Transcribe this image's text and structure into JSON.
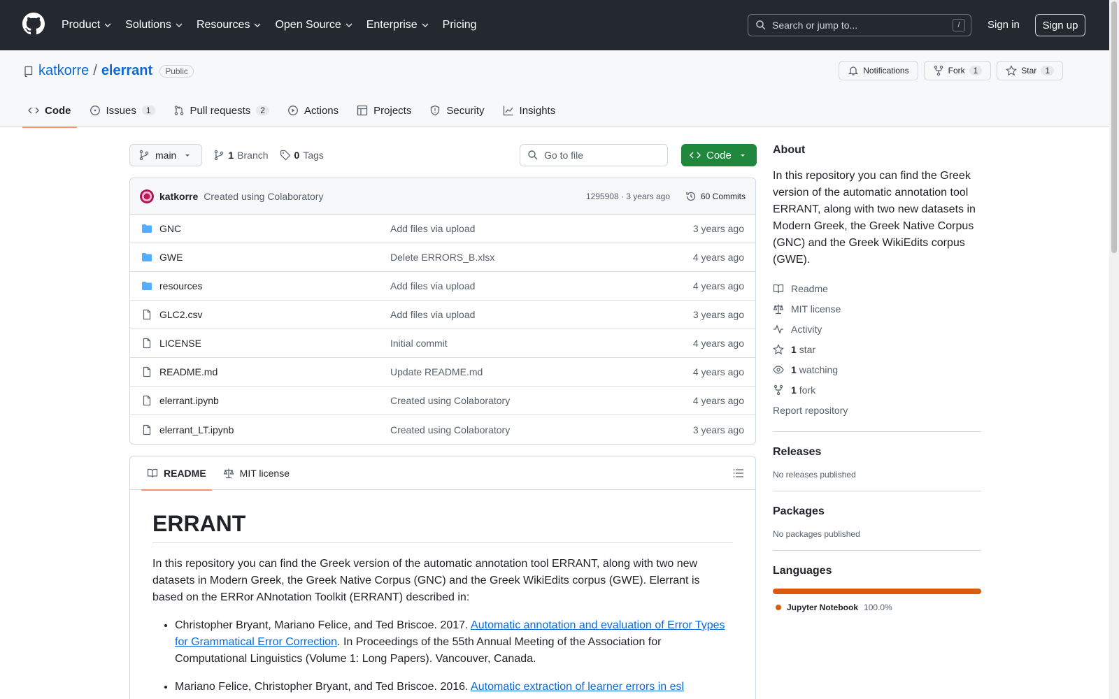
{
  "header": {
    "nav": [
      "Product",
      "Solutions",
      "Resources",
      "Open Source",
      "Enterprise",
      "Pricing"
    ],
    "search_placeholder": "Search or jump to...",
    "search_shortcut": "/",
    "sign_in": "Sign in",
    "sign_up": "Sign up"
  },
  "repo": {
    "owner": "katkorre",
    "separator": "/",
    "name": "elerrant",
    "visibility": "Public",
    "notifications_label": "Notifications",
    "fork_label": "Fork",
    "fork_count": "1",
    "star_label": "Star",
    "star_count": "1",
    "tabs": [
      {
        "label": "Code",
        "count": ""
      },
      {
        "label": "Issues",
        "count": "1"
      },
      {
        "label": "Pull requests",
        "count": "2"
      },
      {
        "label": "Actions",
        "count": ""
      },
      {
        "label": "Projects",
        "count": ""
      },
      {
        "label": "Security",
        "count": ""
      },
      {
        "label": "Insights",
        "count": ""
      }
    ]
  },
  "toolbar": {
    "branch": "main",
    "branch_count": "1",
    "branch_label": "Branch",
    "tag_count": "0",
    "tag_label": "Tags",
    "goto_placeholder": "Go to file",
    "code_button": "Code"
  },
  "commit": {
    "author": "katkorre",
    "message": "Created using Colaboratory",
    "meta": "1295908 · 3 years ago",
    "count_label": "60 Commits"
  },
  "files": [
    {
      "name": "GNC",
      "type": "dir",
      "message": "Add files via upload",
      "age": "3 years ago"
    },
    {
      "name": "GWE",
      "type": "dir",
      "message": "Delete ERRORS_B.xlsx",
      "age": "4 years ago"
    },
    {
      "name": "resources",
      "type": "dir",
      "message": "Add files via upload",
      "age": "4 years ago"
    },
    {
      "name": "GLC2.csv",
      "type": "file",
      "message": "Add files via upload",
      "age": "3 years ago"
    },
    {
      "name": "LICENSE",
      "type": "file",
      "message": "Initial commit",
      "age": "4 years ago"
    },
    {
      "name": "README.md",
      "type": "file",
      "message": "Update README.md",
      "age": "4 years ago"
    },
    {
      "name": "elerrant.ipynb",
      "type": "file",
      "message": "Created using Colaboratory",
      "age": "4 years ago"
    },
    {
      "name": "elerrant_LT.ipynb",
      "type": "file",
      "message": "Created using Colaboratory",
      "age": "3 years ago"
    }
  ],
  "readme": {
    "tab_readme": "README",
    "tab_license": "MIT license",
    "title": "ERRANT",
    "intro": "In this repository you can find the Greek version of the automatic annotation tool ERRANT, along with two new datasets in Modern Greek, the Greek Native Corpus (GNC) and the Greek WikiEdits corpus (GWE). Elerrant is based on the ERRor ANnotation Toolkit (ERRANT) described in:",
    "refs": [
      {
        "pre": "Christopher Bryant, Mariano Felice, and Ted Briscoe. 2017. ",
        "link": "Automatic annotation and evaluation of Error Types for Grammatical Error Correction",
        "post": ". In Proceedings of the 55th Annual Meeting of the Association for Computational Linguistics (Volume 1: Long Papers). Vancouver, Canada."
      },
      {
        "pre": "Mariano Felice, Christopher Bryant, and Ted Briscoe. 2016. ",
        "link": "Automatic extraction of learner errors in esl",
        "post": ""
      }
    ]
  },
  "sidebar": {
    "about_title": "About",
    "about_text": "In this repository you can find the Greek version of the automatic annotation tool ERRANT, along with two new datasets in Modern Greek, the Greek Native Corpus (GNC) and the Greek WikiEdits corpus (GWE).",
    "readme": "Readme",
    "license": "MIT license",
    "activity": "Activity",
    "stars_count": "1",
    "stars_label": "star",
    "watching_count": "1",
    "watching_label": "watching",
    "forks_count": "1",
    "forks_label": "fork",
    "report": "Report repository",
    "releases_title": "Releases",
    "releases_text": "No releases published",
    "packages_title": "Packages",
    "packages_text": "No packages published",
    "languages_title": "Languages",
    "language_name": "Jupyter Notebook",
    "language_pct": "100.0%",
    "language_share": 1.0,
    "language_color": "#da5b0b"
  },
  "colors": {
    "header_bg": "#24292f",
    "link": "#0969da",
    "green": "#1f883d",
    "tab_underline": "#fd8c73"
  }
}
